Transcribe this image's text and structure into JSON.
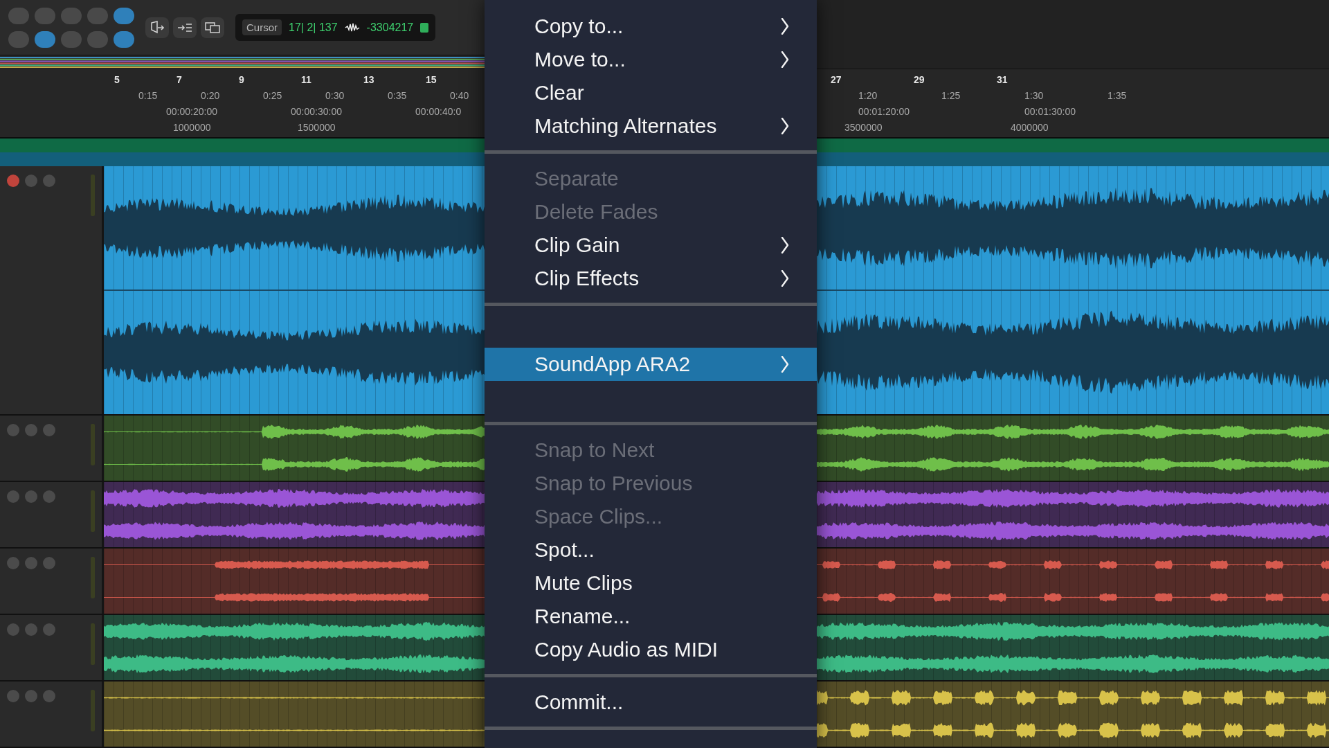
{
  "toolbar": {
    "tool_buttons": [
      {
        "selected": false
      },
      {
        "selected": false
      },
      {
        "selected": false
      },
      {
        "selected": false
      },
      {
        "selected": true
      },
      {
        "selected": false
      },
      {
        "selected": true
      },
      {
        "selected": false
      },
      {
        "selected": false
      },
      {
        "selected": true
      }
    ],
    "cursor_label": "Cursor",
    "counter": "17| 2| 137",
    "samples": "-3304217"
  },
  "ruler_left": {
    "bars": [
      "5",
      "7",
      "9",
      "11",
      "13",
      "15"
    ],
    "times": [
      "0:15",
      "0:20",
      "0:25",
      "0:30",
      "0:35",
      "0:40"
    ],
    "timecodes": [
      "00:00:20:00",
      "00:00:30:00",
      "00:00:40:0"
    ],
    "samples": [
      "1000000",
      "1500000"
    ]
  },
  "context_menu": {
    "groups": [
      {
        "items": [
          {
            "kind": "item",
            "label": "Copy to...",
            "submenu": true,
            "disabled": false,
            "selected": false
          },
          {
            "kind": "item",
            "label": "Move to...",
            "submenu": true,
            "disabled": false,
            "selected": false
          },
          {
            "kind": "item",
            "label": "Clear",
            "submenu": false,
            "disabled": false,
            "selected": false
          },
          {
            "kind": "item",
            "label": "Matching Alternates",
            "submenu": true,
            "disabled": false,
            "selected": false
          }
        ]
      },
      {
        "items": [
          {
            "kind": "item",
            "label": "Separate",
            "submenu": false,
            "disabled": true,
            "selected": false
          },
          {
            "kind": "item",
            "label": "Delete Fades",
            "submenu": false,
            "disabled": true,
            "selected": false
          },
          {
            "kind": "item",
            "label": "Clip Gain",
            "submenu": true,
            "disabled": false,
            "selected": false
          },
          {
            "kind": "item",
            "label": "Clip Effects",
            "submenu": true,
            "disabled": false,
            "selected": false
          }
        ]
      },
      {
        "items": [
          {
            "kind": "spacer"
          },
          {
            "kind": "item",
            "label": "SoundApp ARA2",
            "submenu": true,
            "disabled": false,
            "selected": true
          },
          {
            "kind": "spacer"
          }
        ]
      },
      {
        "items": [
          {
            "kind": "item",
            "label": "Snap to Next",
            "submenu": false,
            "disabled": true,
            "selected": false
          },
          {
            "kind": "item",
            "label": "Snap to Previous",
            "submenu": false,
            "disabled": true,
            "selected": false
          },
          {
            "kind": "item",
            "label": "Space Clips...",
            "submenu": false,
            "disabled": true,
            "selected": false
          },
          {
            "kind": "item",
            "label": "Spot...",
            "submenu": false,
            "disabled": false,
            "selected": false
          },
          {
            "kind": "item",
            "label": "Mute Clips",
            "submenu": false,
            "disabled": false,
            "selected": false
          },
          {
            "kind": "item",
            "label": "Rename...",
            "submenu": false,
            "disabled": false,
            "selected": false
          },
          {
            "kind": "item",
            "label": "Copy Audio as MIDI",
            "submenu": false,
            "disabled": false,
            "selected": false
          }
        ]
      },
      {
        "items": [
          {
            "kind": "item",
            "label": "Commit...",
            "submenu": false,
            "disabled": false,
            "selected": false
          }
        ]
      }
    ]
  },
  "ruler_right": {
    "bars": [
      "27",
      "29",
      "31"
    ],
    "times": [
      "1:20",
      "1:25",
      "1:30",
      "1:35"
    ],
    "timecodes": [
      "00:01:20:00",
      "00:01:30:00"
    ],
    "samples": [
      "3500000",
      "4000000"
    ]
  },
  "tracks": [
    {
      "kind": "filled",
      "color": "#2b9ad4"
    },
    {
      "kind": "sparse",
      "color": "#6fbf4a"
    },
    {
      "kind": "dense",
      "color": "#9a55d6"
    },
    {
      "kind": "sustained",
      "color": "#d75a4e"
    },
    {
      "kind": "dense",
      "color": "#3dbb86"
    },
    {
      "kind": "bursts",
      "color": "#d8c24a"
    }
  ]
}
